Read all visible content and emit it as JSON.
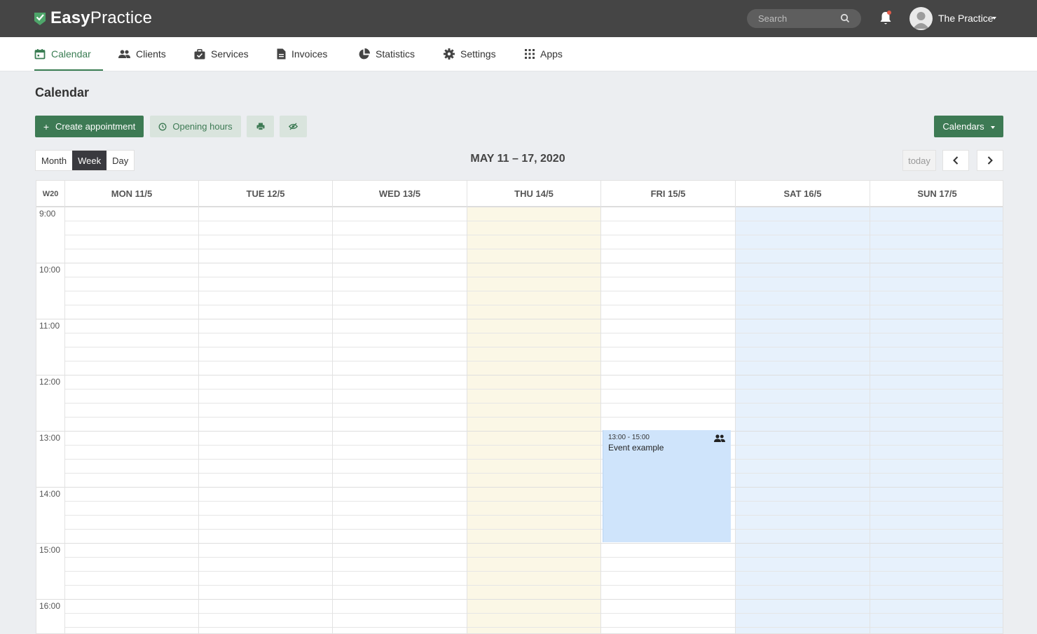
{
  "app": {
    "logo_bold": "Easy",
    "logo_light": "Practice",
    "brand_color": "#3d7a54",
    "topbar_color": "#454545"
  },
  "topbar": {
    "search_placeholder": "Search",
    "user_name": "The Practice"
  },
  "nav": {
    "items": [
      {
        "label": "Calendar",
        "icon": "calendar-icon",
        "active": true
      },
      {
        "label": "Clients",
        "icon": "clients-icon"
      },
      {
        "label": "Services",
        "icon": "services-icon"
      },
      {
        "label": "Invoices",
        "icon": "invoices-icon"
      },
      {
        "label": "Statistics",
        "icon": "statistics-icon"
      },
      {
        "label": "Settings",
        "icon": "gear-icon"
      },
      {
        "label": "Apps",
        "icon": "apps-grid-icon"
      }
    ]
  },
  "page": {
    "title": "Calendar"
  },
  "toolbar": {
    "create_label": "Create appointment",
    "create_prefix": "+",
    "opening_hours_label": "Opening hours",
    "calendars_label": "Calendars"
  },
  "view": {
    "buttons": [
      "Month",
      "Week",
      "Day"
    ],
    "active": "Week",
    "range_title": "MAY 11 – 17, 2020",
    "today_label": "today"
  },
  "calendar": {
    "week_label": "W20",
    "days": [
      "MON 11/5",
      "TUE 12/5",
      "WED 13/5",
      "THU 14/5",
      "FRI 15/5",
      "SAT 16/5",
      "SUN 17/5"
    ],
    "times": [
      "9:00",
      "10:00",
      "11:00",
      "12:00",
      "13:00",
      "14:00",
      "15:00",
      "16:00"
    ],
    "today_color": "#fbf7e6",
    "weekend_color": "#e7f1fc",
    "events": [
      {
        "time": "13:00 - 15:00",
        "title": "Event example",
        "day": "FRI 15/5",
        "color": "#cfe4fb"
      }
    ]
  }
}
